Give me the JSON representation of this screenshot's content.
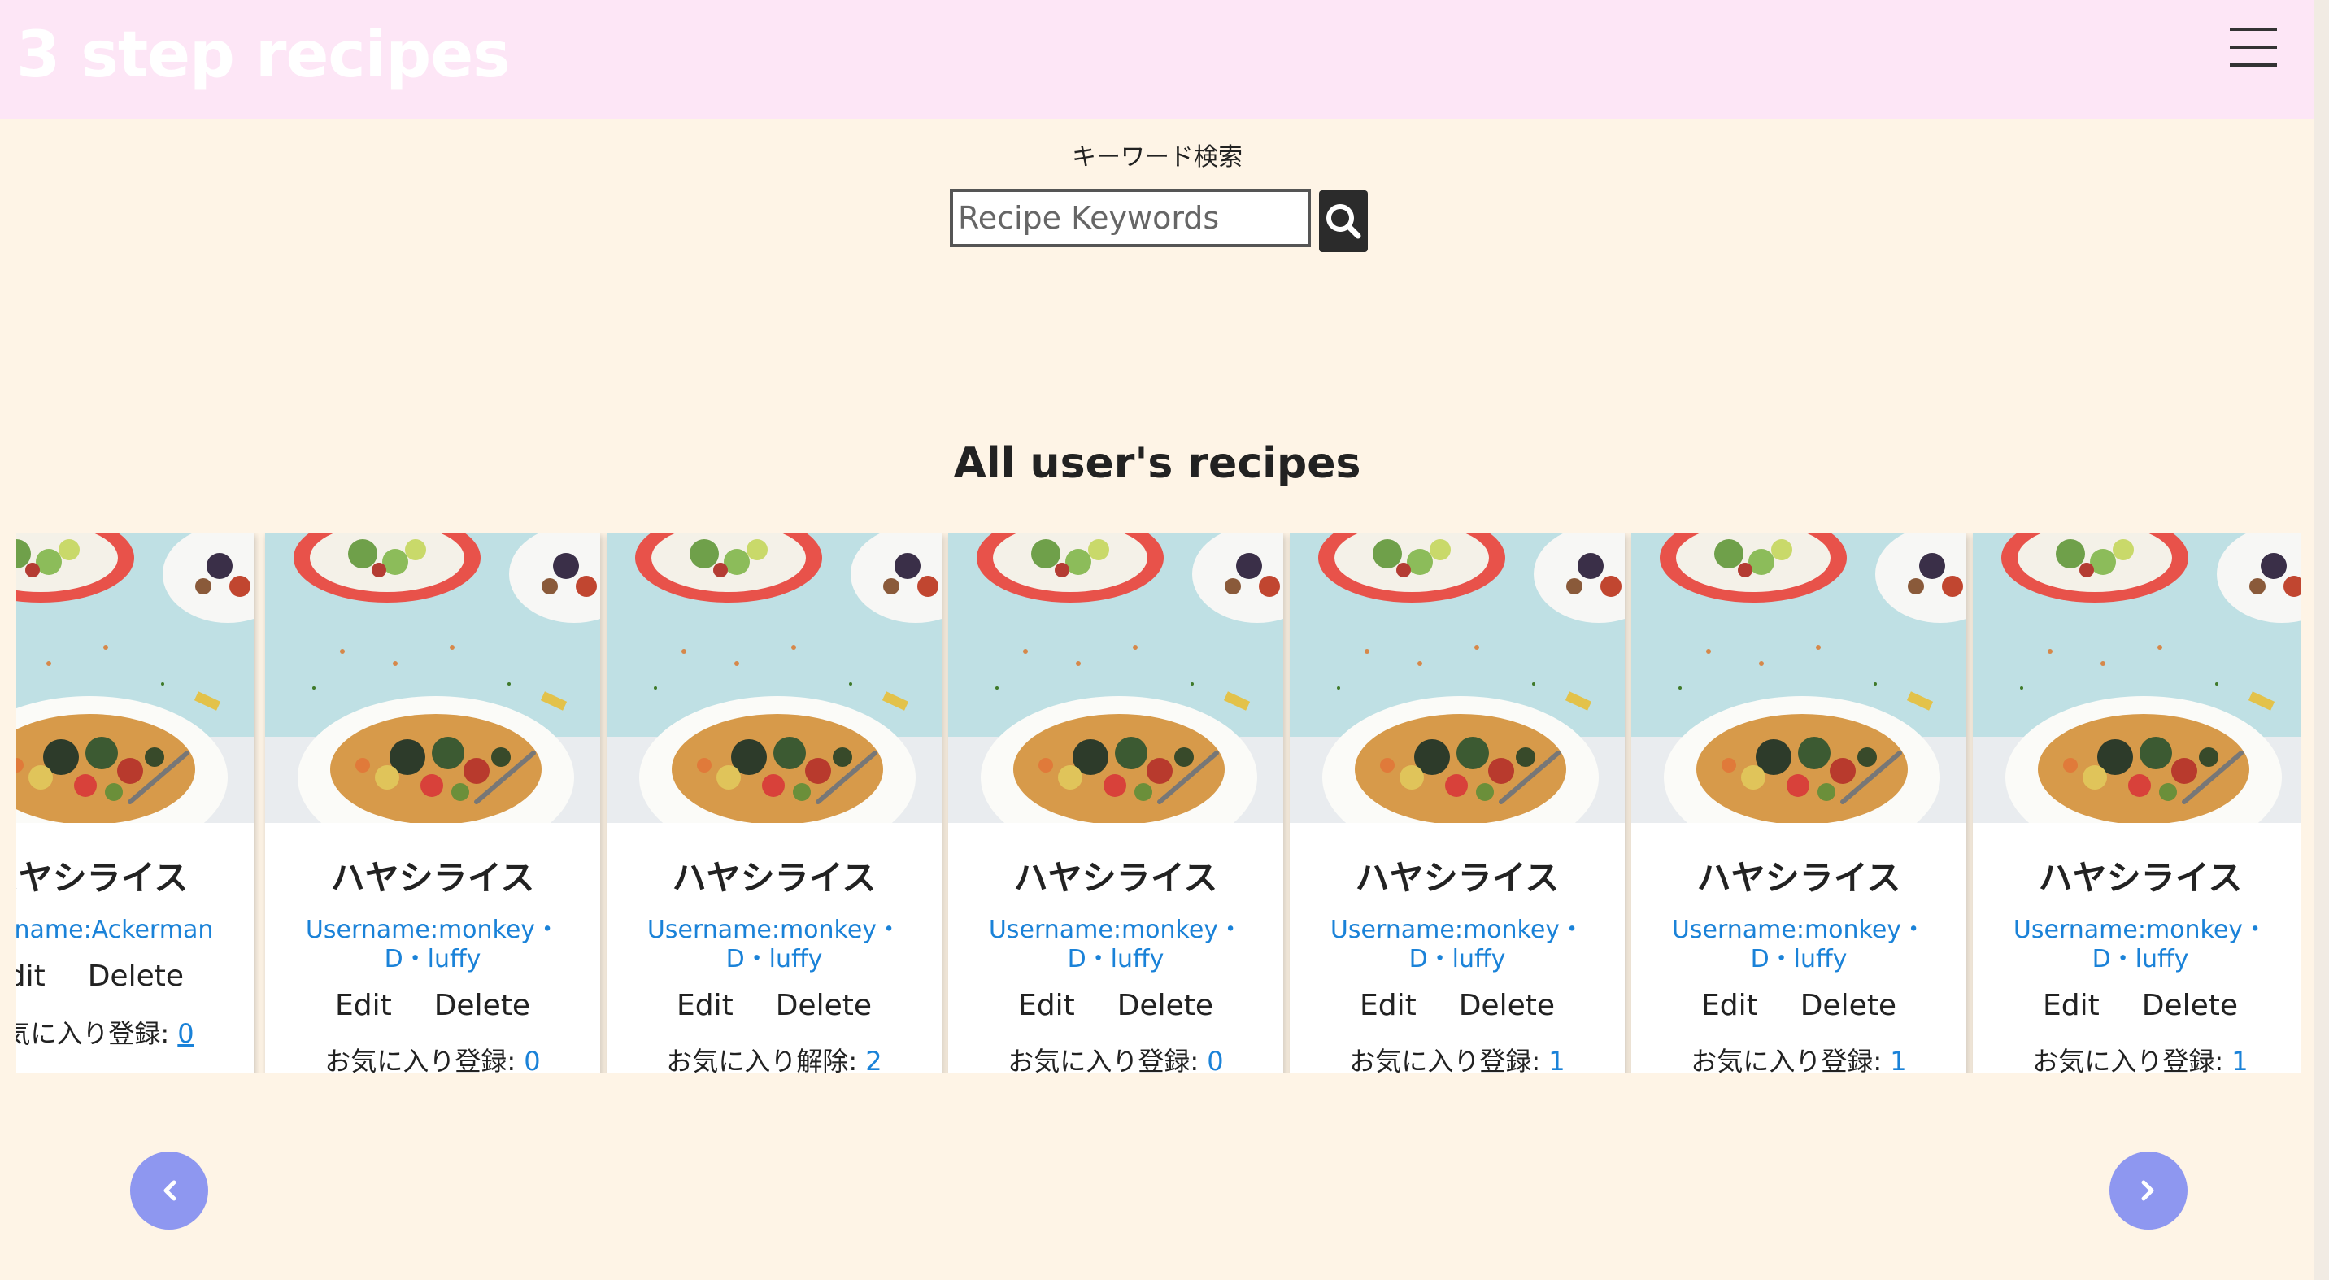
{
  "header": {
    "brand": "3 step recipes"
  },
  "search": {
    "label": "キーワード検索",
    "placeholder": "Recipe Keywords"
  },
  "section": {
    "title": "All user's recipes"
  },
  "cards": [
    {
      "title": "ハヤシライス",
      "username": "Username:Ackerman",
      "edit": "Edit",
      "delete": "Delete",
      "fav_label": "お気に入り登録:",
      "fav_count": "0"
    },
    {
      "title": "ハヤシライス",
      "username": "Username:monkey・D・luffy",
      "edit": "Edit",
      "delete": "Delete",
      "fav_label": "お気に入り登録:",
      "fav_count": "0"
    },
    {
      "title": "ハヤシライス",
      "username": "Username:monkey・D・luffy",
      "edit": "Edit",
      "delete": "Delete",
      "fav_label": "お気に入り解除:",
      "fav_count": "2"
    },
    {
      "title": "ハヤシライス",
      "username": "Username:monkey・D・luffy",
      "edit": "Edit",
      "delete": "Delete",
      "fav_label": "お気に入り登録:",
      "fav_count": "0"
    },
    {
      "title": "ハヤシライス",
      "username": "Username:monkey・D・luffy",
      "edit": "Edit",
      "delete": "Delete",
      "fav_label": "お気に入り登録:",
      "fav_count": "1"
    },
    {
      "title": "ハヤシライス",
      "username": "Username:monkey・D・luffy",
      "edit": "Edit",
      "delete": "Delete",
      "fav_label": "お気に入り登録:",
      "fav_count": "1"
    },
    {
      "title": "ハヤシライス",
      "username": "Username:monkey・D・luffy",
      "edit": "Edit",
      "delete": "Delete",
      "fav_label": "お気に入り登録:",
      "fav_count": "1"
    }
  ],
  "icons": {
    "menu": "hamburger-menu-icon",
    "search": "search-icon",
    "prev": "chevron-left-icon",
    "next": "chevron-right-icon"
  },
  "colors": {
    "header_bg": "#fde6f6",
    "page_bg": "#fef4e6",
    "link": "#1a82d8",
    "nav_button": "#8e97f0"
  }
}
